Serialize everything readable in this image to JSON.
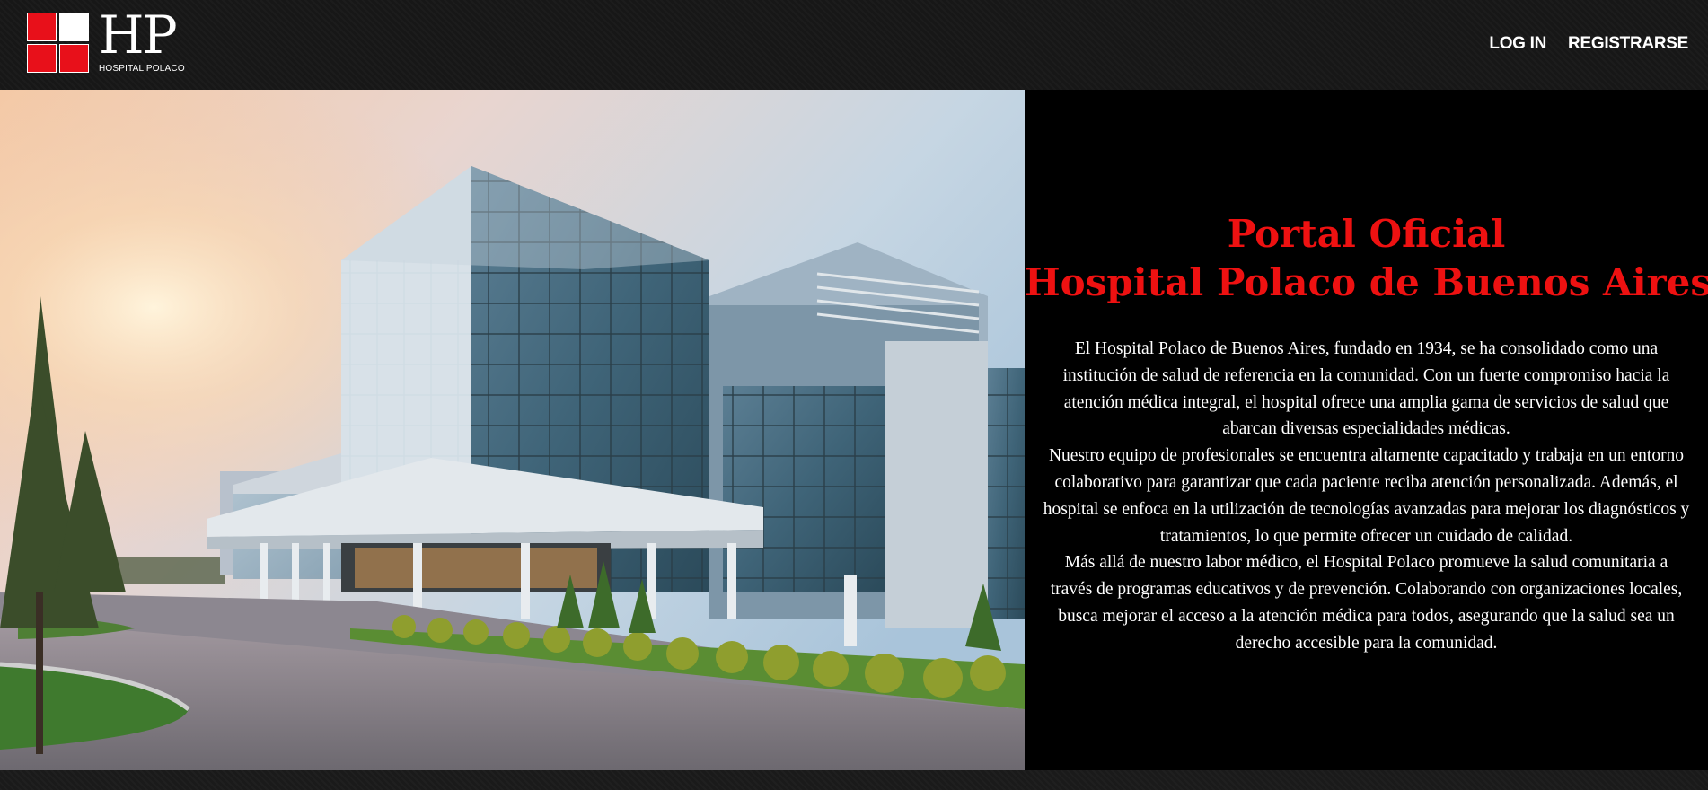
{
  "brand": {
    "letters": "HP",
    "name": "HOSPITAL POLACO",
    "red": "#e8101a"
  },
  "nav": {
    "login": "LOG IN",
    "register": "REGISTRARSE"
  },
  "hero": {
    "image_alt": "Edificio moderno de vidrio del hospital al atardecer"
  },
  "content": {
    "title_line1": "Portal Oficial",
    "title_line2": "Hospital Polaco de Buenos Aires",
    "title_color": "#ee1111",
    "paragraph1": "El Hospital Polaco de Buenos Aires, fundado en 1934, se ha consolidado como una institución de salud de referencia en la comunidad. Con un fuerte compromiso hacia la atención médica integral, el hospital ofrece una amplia gama de servicios de salud que abarcan diversas especialidades médicas.",
    "paragraph2": "Nuestro equipo de profesionales se encuentra altamente capacitado y trabaja en un entorno colaborativo para garantizar que cada paciente reciba atención personalizada. Además, el hospital se enfoca en la utilización de tecnologías avanzadas para mejorar los diagnósticos y tratamientos, lo que permite ofrecer un cuidado de calidad.",
    "paragraph3": "Más allá de nuestro labor médico, el Hospital Polaco promueve la salud comunitaria a través de programas educativos y de prevención. Colaborando con organizaciones locales, busca mejorar el acceso a la atención médica para todos, asegurando que la salud sea un derecho accesible para la comunidad."
  }
}
